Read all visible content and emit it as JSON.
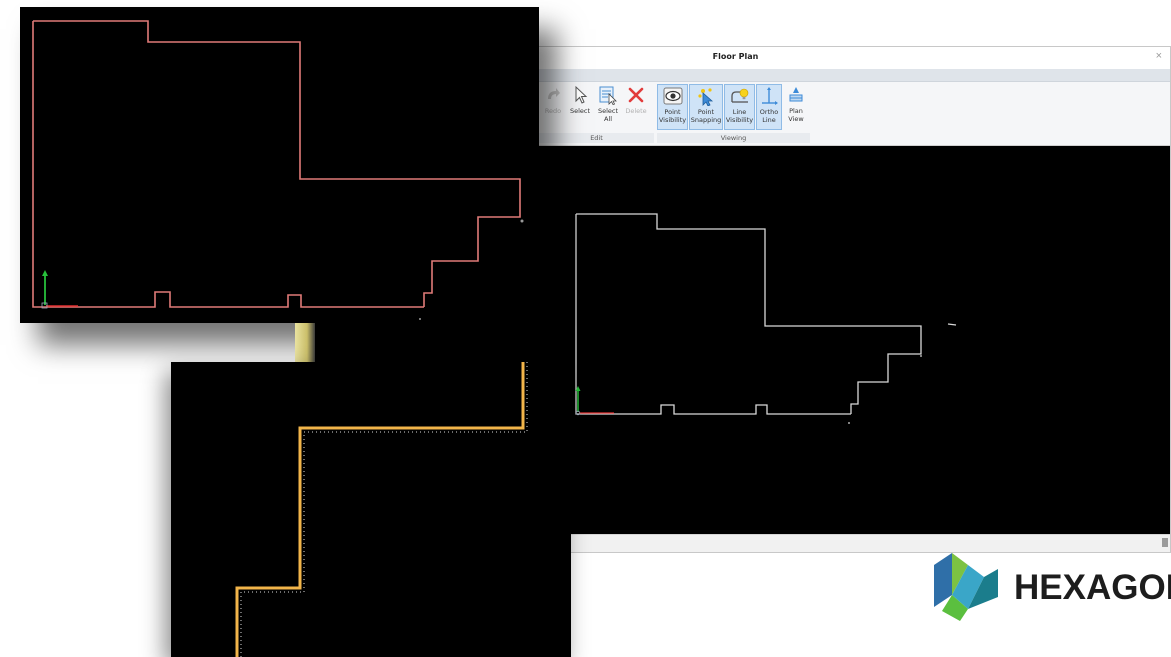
{
  "window": {
    "title": "Floor Plan",
    "close_glyph": "×"
  },
  "ribbon": {
    "buttons": [
      {
        "label": "Redo",
        "icon": "redo-icon",
        "state": "disabled"
      },
      {
        "label": "Select",
        "icon": "cursor-icon",
        "state": "normal"
      },
      {
        "label": "Select\nAll",
        "icon": "select-all-icon",
        "state": "normal"
      },
      {
        "label": "Delete",
        "icon": "delete-x-icon",
        "state": "disabled"
      },
      {
        "label": "Point\nVisibility",
        "icon": "eye-icon",
        "state": "active"
      },
      {
        "label": "Point\nSnapping",
        "icon": "snap-cursor-icon",
        "state": "active"
      },
      {
        "label": "Line\nVisibility",
        "icon": "bulb-line-icon",
        "state": "active"
      },
      {
        "label": "Ortho\nLine",
        "icon": "ortho-axis-icon",
        "state": "active"
      },
      {
        "label": "Plan\nView",
        "icon": "plan-view-icon",
        "state": "normal"
      }
    ],
    "groups": [
      {
        "label": "Edit"
      },
      {
        "label": "Viewing"
      }
    ]
  },
  "logo": {
    "text": "HEXAGON",
    "colors": [
      "#2f6fa8",
      "#3aa6c8",
      "#7cc242",
      "#1b7d8c"
    ]
  },
  "colors": {
    "canvas": "#000000",
    "outline_main": "#d9d9d9",
    "outline_red": "#e07a78",
    "outline_yellow": "#f2b54a",
    "axis_y": "#27c03b",
    "axis_x": "#e03030"
  }
}
